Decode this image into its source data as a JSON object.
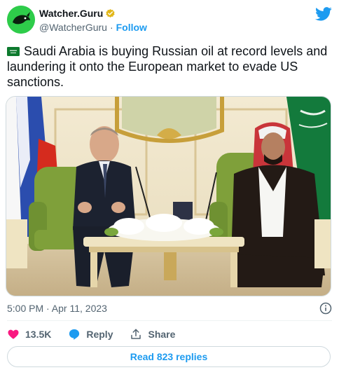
{
  "account": {
    "display_name": "Watcher.Guru",
    "handle": "@WatcherGuru",
    "separator": "·",
    "follow_label": "Follow",
    "verified_icon": "verified-gold-badge-icon",
    "avatar_color": "#2ecc4a"
  },
  "tweet": {
    "flag_icon": "saudi-arabia-flag-icon",
    "text": "Saudi Arabia is buying Russian oil at record levels and laundering it onto the European market to evade US sanctions.",
    "timestamp": "5:00 PM · Apr 11, 2023"
  },
  "actions": {
    "likes_count": "13.5K",
    "reply_label": "Reply",
    "share_label": "Share"
  },
  "read_replies_label": "Read 823 replies",
  "colors": {
    "accent": "#1d9bf0",
    "like": "#f91880",
    "muted": "#536471",
    "text": "#0f1419"
  }
}
